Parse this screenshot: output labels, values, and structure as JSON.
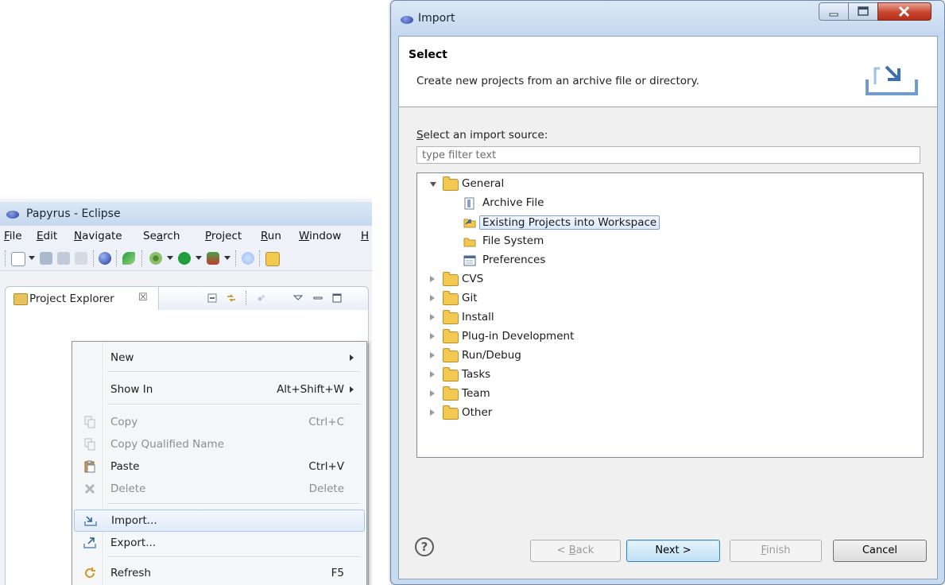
{
  "eclipse": {
    "title": "Papyrus - Eclipse",
    "menu": [
      "File",
      "Edit",
      "Navigate",
      "Search",
      "Project",
      "Run",
      "Window",
      "H"
    ],
    "view_tab": "Project Explorer",
    "view_tab_close": "☒"
  },
  "context_menu": {
    "items": [
      {
        "label": "New",
        "shortcut": "",
        "submenu": true,
        "enabled": true,
        "icon": ""
      },
      {
        "label": "Show In",
        "shortcut": "Alt+Shift+W",
        "submenu": true,
        "enabled": true,
        "icon": ""
      },
      {
        "label": "Copy",
        "shortcut": "Ctrl+C",
        "submenu": false,
        "enabled": false,
        "icon": "copy-icon"
      },
      {
        "label": "Copy Qualified Name",
        "shortcut": "",
        "submenu": false,
        "enabled": false,
        "icon": "copy-qualified-icon"
      },
      {
        "label": "Paste",
        "shortcut": "Ctrl+V",
        "submenu": false,
        "enabled": true,
        "icon": "paste-icon"
      },
      {
        "label": "Delete",
        "shortcut": "Delete",
        "submenu": false,
        "enabled": false,
        "icon": "delete-icon"
      },
      {
        "label": "Import...",
        "shortcut": "",
        "submenu": false,
        "enabled": true,
        "icon": "import-icon",
        "highlighted": true
      },
      {
        "label": "Export...",
        "shortcut": "",
        "submenu": false,
        "enabled": true,
        "icon": "export-icon"
      },
      {
        "label": "Refresh",
        "shortcut": "F5",
        "submenu": false,
        "enabled": true,
        "icon": "refresh-icon"
      }
    ]
  },
  "dialog": {
    "title": "Import",
    "banner_heading": "Select",
    "banner_description": "Create new projects from an archive file or directory.",
    "source_label": "Select an import source:",
    "filter_placeholder": "type filter text",
    "tree": [
      {
        "label": "General",
        "expanded": true,
        "children": [
          {
            "label": "Archive File",
            "icon": "archive-file-icon"
          },
          {
            "label": "Existing Projects into Workspace",
            "icon": "existing-projects-icon",
            "selected": true
          },
          {
            "label": "File System",
            "icon": "file-system-icon"
          },
          {
            "label": "Preferences",
            "icon": "preferences-icon"
          }
        ]
      },
      {
        "label": "CVS",
        "expanded": false
      },
      {
        "label": "Git",
        "expanded": false
      },
      {
        "label": "Install",
        "expanded": false
      },
      {
        "label": "Plug-in Development",
        "expanded": false
      },
      {
        "label": "Run/Debug",
        "expanded": false
      },
      {
        "label": "Tasks",
        "expanded": false
      },
      {
        "label": "Team",
        "expanded": false
      },
      {
        "label": "Other",
        "expanded": false
      }
    ],
    "buttons": {
      "help": "?",
      "back": "< Back",
      "next": "Next >",
      "finish": "Finish",
      "cancel": "Cancel"
    }
  },
  "colors": {
    "dialog_frame": "#c8daee",
    "selection_border": "#7da2ce",
    "close_button": "#c7452d",
    "folder": "#f2c84f"
  }
}
